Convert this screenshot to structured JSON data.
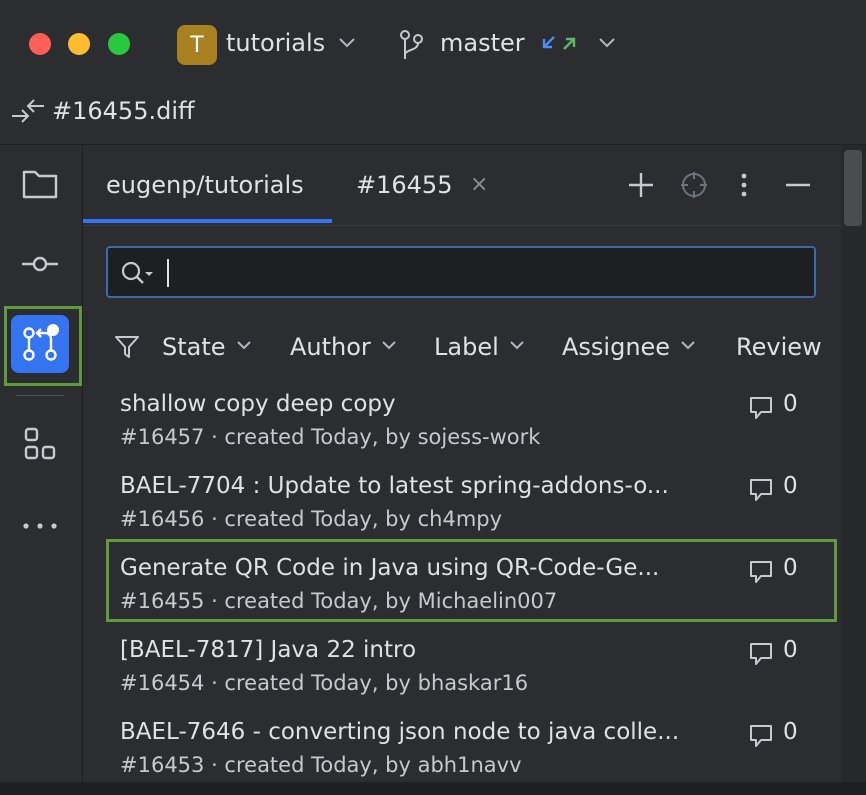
{
  "window": {
    "project_initial": "T",
    "project_name": "tutorials",
    "branch_name": "master"
  },
  "editor_tab": {
    "file_name": "#16455.diff"
  },
  "panel": {
    "tabs": [
      {
        "label": "eugenp/tutorials"
      },
      {
        "label": "#16455"
      }
    ],
    "close_glyph": "×",
    "search": {
      "value": "",
      "placeholder": ""
    },
    "filters": [
      {
        "label": "State"
      },
      {
        "label": "Author"
      },
      {
        "label": "Label"
      },
      {
        "label": "Assignee"
      },
      {
        "label": "Review"
      }
    ],
    "pull_requests": [
      {
        "title": "shallow copy deep copy",
        "subtitle": "#16457 · created Today, by sojess-work",
        "comments": "0"
      },
      {
        "title": "BAEL-7704 : Update to latest spring-addons-o...",
        "subtitle": "#16456 · created Today, by ch4mpy",
        "comments": "0"
      },
      {
        "title": "Generate QR Code in Java using QR-Code-Ge...",
        "subtitle": "#16455 · created Today, by Michaelin007",
        "comments": "0"
      },
      {
        "title": "[BAEL-7817] Java 22 intro",
        "subtitle": "#16454 · created Today, by bhaskar16",
        "comments": "0"
      },
      {
        "title": "BAEL-7646 - converting json node to java colle...",
        "subtitle": "#16453 · created Today, by abh1navv",
        "comments": "0"
      }
    ]
  },
  "icons": {
    "project_tool": "folder-icon",
    "commit_tool": "commit-icon",
    "pull_requests_tool": "pull-request-icon",
    "structure_tool": "plugins-icon",
    "more_tools": "more-icon"
  },
  "colors": {
    "accent": "#3574f0",
    "highlight_frame": "#5f9a3c",
    "project_badge": "#a8801f"
  }
}
